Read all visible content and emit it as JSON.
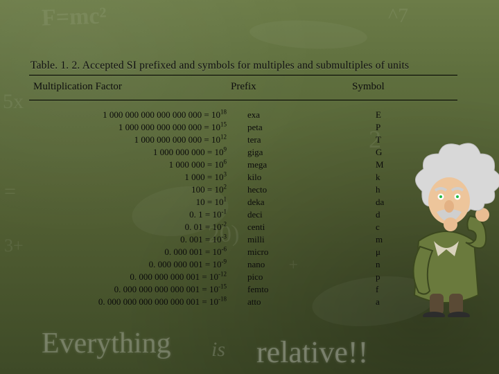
{
  "title": "Table. 1. 2. Accepted SI prefixed and symbols for multiples and submultiples of units",
  "headers": {
    "factor": "Multiplication Factor",
    "prefix": "Prefix",
    "symbol": "Symbol"
  },
  "rows": [
    {
      "mantissa": "1 000 000 000 000 000 000",
      "exp": "18",
      "prefix": "exa",
      "symbol": "E"
    },
    {
      "mantissa": "1 000 000 000 000 000",
      "exp": "15",
      "prefix": "peta",
      "symbol": "P"
    },
    {
      "mantissa": "1 000 000 000 000",
      "exp": "12",
      "prefix": "tera",
      "symbol": "T"
    },
    {
      "mantissa": "1 000 000 000",
      "exp": "9",
      "prefix": "giga",
      "symbol": "G"
    },
    {
      "mantissa": "1 000 000",
      "exp": "6",
      "prefix": "mega",
      "symbol": "M"
    },
    {
      "mantissa": "1 000",
      "exp": "3",
      "prefix": "kilo",
      "symbol": "k"
    },
    {
      "mantissa": "100",
      "exp": "2",
      "prefix": "hecto",
      "symbol": "h"
    },
    {
      "mantissa": "10",
      "exp": "1",
      "prefix": "deka",
      "symbol": "da"
    },
    {
      "mantissa": "0. 1",
      "exp": "-1",
      "prefix": "deci",
      "symbol": "d"
    },
    {
      "mantissa": "0. 01",
      "exp": "-2",
      "prefix": "centi",
      "symbol": "c"
    },
    {
      "mantissa": "0. 001",
      "exp": "-3",
      "prefix": "milli",
      "symbol": "m"
    },
    {
      "mantissa": "0. 000 001",
      "exp": "-6",
      "prefix": "micro",
      "symbol": "μ"
    },
    {
      "mantissa": "0. 000 000 001",
      "exp": "-9",
      "prefix": "nano",
      "symbol": "n"
    },
    {
      "mantissa": "0. 000 000 000 001",
      "exp": "-12",
      "prefix": "pico",
      "symbol": "p"
    },
    {
      "mantissa": "0. 000 000 000 000 001",
      "exp": "-15",
      "prefix": "femto",
      "symbol": "f"
    },
    {
      "mantissa": "0. 000 000 000 000 000 001",
      "exp": "-18",
      "prefix": "atto",
      "symbol": "a"
    }
  ],
  "chalk": {
    "formula": "F=mc²",
    "fivex": "5x",
    "equals": "=",
    "threeplus": "3+",
    "twenty": "20)",
    "caret": "^7",
    "two": "2",
    "plus": "+",
    "everything": "Everything",
    "is": "is",
    "relative": "relative!!"
  },
  "chart_data": {
    "type": "table",
    "title": "Accepted SI prefixed and symbols for multiples and submultiples of units",
    "columns": [
      "Multiplication Factor",
      "Prefix",
      "Symbol"
    ],
    "rows": [
      [
        "1 000 000 000 000 000 000 = 10^18",
        "exa",
        "E"
      ],
      [
        "1 000 000 000 000 000 = 10^15",
        "peta",
        "P"
      ],
      [
        "1 000 000 000 000 = 10^12",
        "tera",
        "T"
      ],
      [
        "1 000 000 000 = 10^9",
        "giga",
        "G"
      ],
      [
        "1 000 000 = 10^6",
        "mega",
        "M"
      ],
      [
        "1 000 = 10^3",
        "kilo",
        "k"
      ],
      [
        "100 = 10^2",
        "hecto",
        "h"
      ],
      [
        "10 = 10^1",
        "deka",
        "da"
      ],
      [
        "0.1 = 10^-1",
        "deci",
        "d"
      ],
      [
        "0.01 = 10^-2",
        "centi",
        "c"
      ],
      [
        "0.001 = 10^-3",
        "milli",
        "m"
      ],
      [
        "0.000 001 = 10^-6",
        "micro",
        "μ"
      ],
      [
        "0.000 000 001 = 10^-9",
        "nano",
        "n"
      ],
      [
        "0.000 000 000 001 = 10^-12",
        "pico",
        "p"
      ],
      [
        "0.000 000 000 000 001 = 10^-15",
        "femto",
        "f"
      ],
      [
        "0.000 000 000 000 000 001 = 10^-18",
        "atto",
        "a"
      ]
    ]
  }
}
